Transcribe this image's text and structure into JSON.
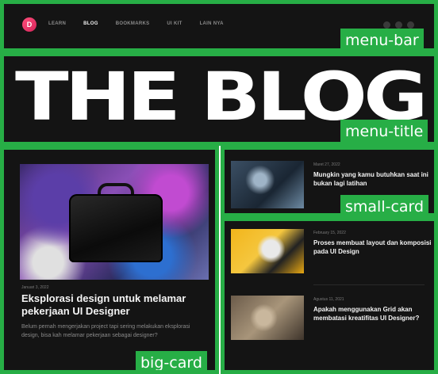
{
  "menu_bar": {
    "logo": "D",
    "nav": [
      "LEARN",
      "BLOG",
      "BOOKMARKS",
      "UI KIT",
      "LAIN NYA"
    ],
    "tag": "menu-bar"
  },
  "menu_title": {
    "heading": "THE BLOG",
    "tag": "menu-title"
  },
  "big_card": {
    "date": "Januari 3, 2022",
    "title": "Eksplorasi design untuk melamar pekerjaan UI Designer",
    "description": "Belum pernah mengerjakan project tapi sering melakukan eksplorasi design, bisa kah melamar pekerjaan sebagai designer?",
    "tag": "big-card"
  },
  "small_card": {
    "date": "Maret 27, 2022",
    "title": "Mungkin yang kamu butuhkan saat ini bukan lagi latihan",
    "tag": "small-card"
  },
  "list_cards": [
    {
      "date": "February 15, 2022",
      "title": "Proses membuat layout dan komposisi pada UI Design"
    },
    {
      "date": "Agustus 11, 2021",
      "title": "Apakah menggunakan Grid akan membatasi kreatifitas UI Designer?"
    }
  ],
  "colors": {
    "frame_border": "#27ae46",
    "background": "#141414",
    "accent": "#e0326a"
  }
}
